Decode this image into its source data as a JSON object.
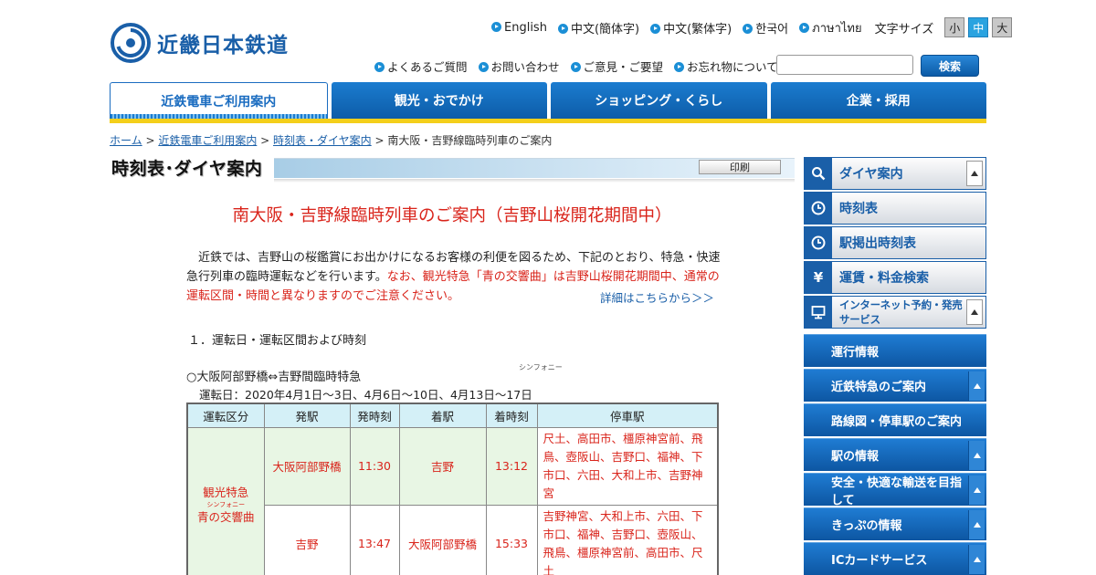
{
  "header": {
    "logo_text": "近畿日本鉄道",
    "languages": [
      "English",
      "中文(簡体字)",
      "中文(繁体字)",
      "한국어",
      "ภาษาไทย"
    ],
    "font_size_label": "文字サイズ",
    "font_sizes": [
      "小",
      "中",
      "大"
    ],
    "util_links": [
      "よくあるご質問",
      "お問い合わせ",
      "ご意見・ご要望",
      "お忘れ物について"
    ],
    "search_value": "",
    "search_button": "検索"
  },
  "gnav": [
    "近鉄電車ご利用案内",
    "観光・おでかけ",
    "ショッピング・くらし",
    "企業・採用"
  ],
  "breadcrumb": {
    "home": "ホーム",
    "sep": " > ",
    "l1": "近鉄電車ご利用案内",
    "l2": "時刻表・ダイヤ案内",
    "current": "南大阪・吉野線臨時列車のご案内"
  },
  "page": {
    "title": "時刻表･ダイヤ案内",
    "print": "印刷",
    "heading": "南大阪・吉野線臨時列車のご案内（吉野山桜開花期間中）",
    "intro_black": "　近鉄では、吉野山の桜鑑賞にお出かけになるお客様の利便を図るため、下記のとおり、特急・快速急行列車の臨時運転などを行います。",
    "intro_red": "なお、観光特急「青の交響曲」は吉野山桜開花期間中、通常の運転区間・時間と異なりますのでご注意ください。",
    "ruby_symphony": "シンフォニー",
    "detail_link": "詳細はこちらから＞＞",
    "section1": "１．運転日・運転区間および時刻",
    "route": "○大阪阿部野橋⇔吉野間臨時特急",
    "dates": "運転日：2020年4月1日～3日、4月6日～10日、4月13日～17日"
  },
  "table": {
    "headers": [
      "運転区分",
      "発駅",
      "発時刻",
      "着駅",
      "着時刻",
      "停車駅"
    ],
    "kind_line1": "観光特急",
    "kind_ruby": "シンフォニー",
    "kind_line2": "青の交響曲",
    "rows": [
      {
        "from": "大阪阿部野橋",
        "dep": "11:30",
        "to": "吉野",
        "arr": "13:12",
        "stops": "尺土、高田市、橿原神宮前、飛鳥、壺阪山、吉野口、福神、下市口、六田、大和上市、吉野神宮"
      },
      {
        "from": "吉野",
        "dep": "13:47",
        "to": "大阪阿部野橋",
        "arr": "15:33",
        "stops": "吉野神宮、大和上市、六田、下市口、福神、吉野口、壺阪山、飛鳥、橿原神宮前、高田市、尺土"
      }
    ]
  },
  "sidebar": {
    "main": [
      {
        "label": "ダイヤ案内",
        "icon": "search-icon",
        "glyph": "🔍",
        "arrow": true
      },
      {
        "label": "時刻表",
        "icon": "clock-icon",
        "glyph": "◷",
        "arrow": false
      },
      {
        "label": "駅掲出時刻表",
        "icon": "clock-icon",
        "glyph": "◷",
        "arrow": false
      },
      {
        "label": "運賃・料金検索",
        "icon": "yen-icon",
        "glyph": "¥",
        "arrow": false
      },
      {
        "label": "インターネット予約・発売サービス",
        "icon": "monitor-icon",
        "glyph": "▭",
        "arrow": true
      }
    ],
    "sub": [
      {
        "label": "運行情報",
        "arrow": false
      },
      {
        "label": "近鉄特急のご案内",
        "arrow": true
      },
      {
        "label": "路線図・停車駅のご案内",
        "arrow": false
      },
      {
        "label": "駅の情報",
        "arrow": true
      },
      {
        "label": "安全・快適な輸送を目指して",
        "arrow": true
      },
      {
        "label": "きっぷの情報",
        "arrow": true
      },
      {
        "label": "ICカードサービス",
        "arrow": true
      }
    ]
  },
  "colors": {
    "accent": "#1a5fa8",
    "red_text": "#d9241b",
    "nav_underline": "#f4cf1a"
  }
}
